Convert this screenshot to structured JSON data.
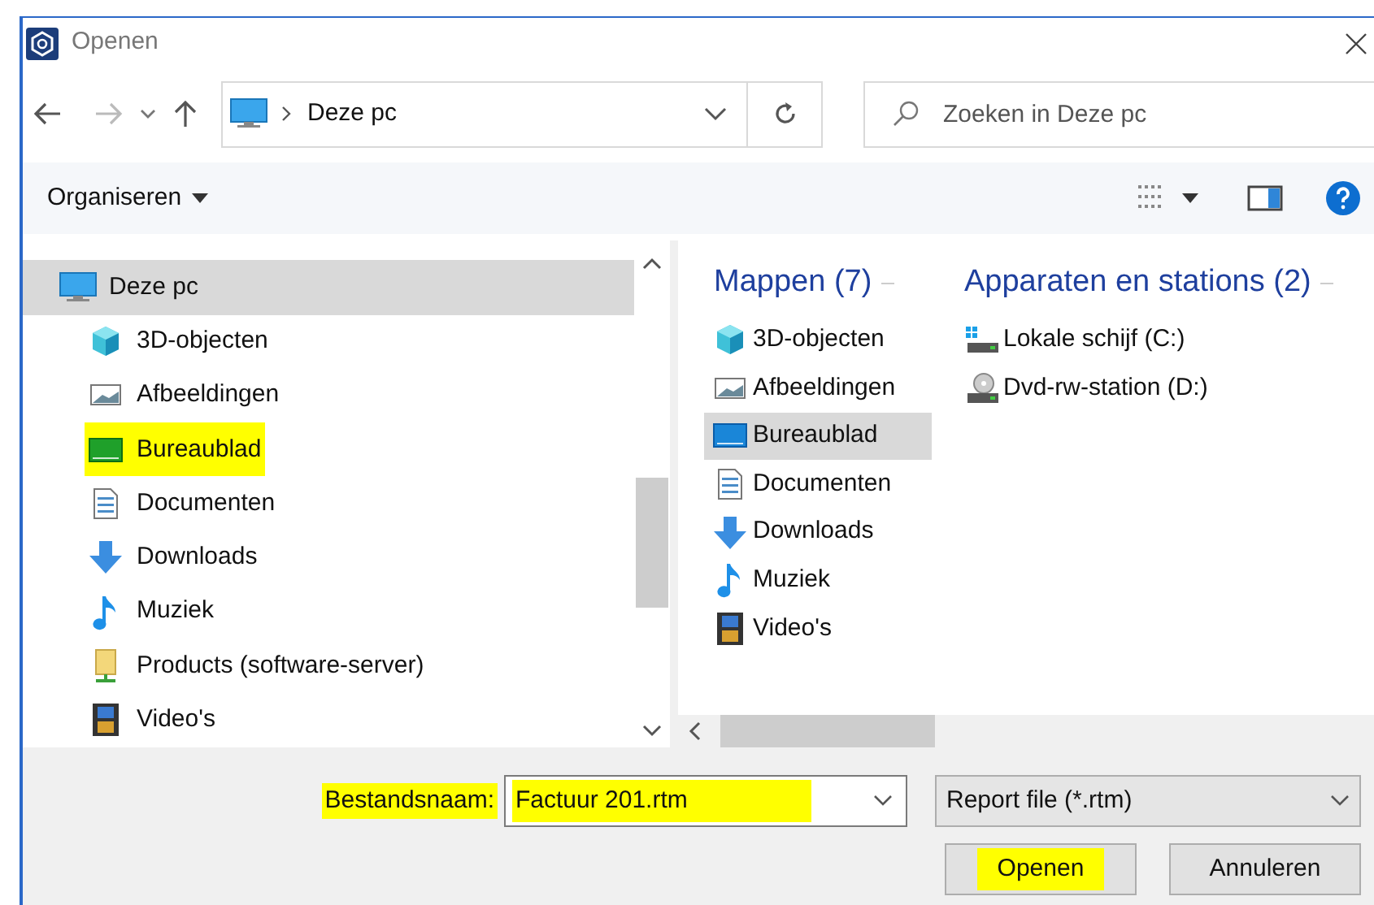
{
  "window": {
    "title": "Openen"
  },
  "address": {
    "location": "Deze pc"
  },
  "search": {
    "placeholder": "Zoeken in Deze pc"
  },
  "toolbar": {
    "organize": "Organiseren"
  },
  "nav": {
    "root": {
      "label": "Deze pc",
      "selected": true
    },
    "items": [
      {
        "label": "3D-objecten",
        "kind": "cube",
        "highlighted": false
      },
      {
        "label": "Afbeeldingen",
        "kind": "image",
        "highlighted": false
      },
      {
        "label": "Bureaublad",
        "kind": "desktop",
        "highlighted": true
      },
      {
        "label": "Documenten",
        "kind": "doc",
        "highlighted": false
      },
      {
        "label": "Downloads",
        "kind": "download",
        "highlighted": false
      },
      {
        "label": "Muziek",
        "kind": "music",
        "highlighted": false
      },
      {
        "label": "Products (software-server)",
        "kind": "netfolder",
        "highlighted": false
      },
      {
        "label": "Video's",
        "kind": "video",
        "highlighted": false
      }
    ]
  },
  "folders": {
    "heading": "Mappen (7)",
    "items": [
      {
        "label": "3D-objecten",
        "kind": "cube",
        "selected": false
      },
      {
        "label": "Afbeeldingen",
        "kind": "image",
        "selected": false
      },
      {
        "label": "Bureaublad",
        "kind": "desktop",
        "selected": true
      },
      {
        "label": "Documenten",
        "kind": "doc",
        "selected": false
      },
      {
        "label": "Downloads",
        "kind": "download",
        "selected": false
      },
      {
        "label": "Muziek",
        "kind": "music",
        "selected": false
      },
      {
        "label": "Video's",
        "kind": "video",
        "selected": false
      }
    ]
  },
  "devices": {
    "heading": "Apparaten en stations (2)",
    "items": [
      {
        "label": "Lokale schijf (C:)",
        "kind": "drive"
      },
      {
        "label": "Dvd-rw-station (D:)",
        "kind": "dvd"
      }
    ]
  },
  "footer": {
    "filename_label": "Bestandsnaam:",
    "filename_label_highlighted": true,
    "filename": "Factuur 201.rtm",
    "filename_highlighted": true,
    "filetype": "Report file (*.rtm)",
    "open": "Openen",
    "open_highlighted": true,
    "cancel": "Annuleren"
  }
}
